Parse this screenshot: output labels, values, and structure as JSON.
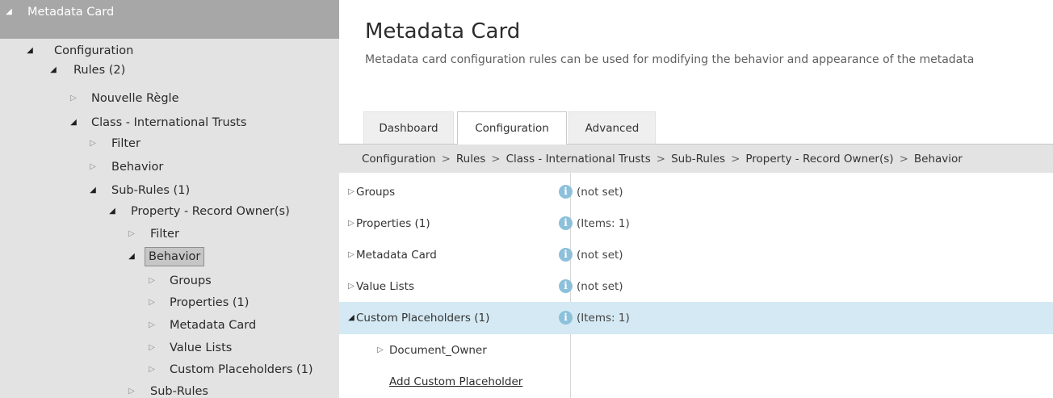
{
  "tree": {
    "nodes": [
      {
        "label": "Metadata Card",
        "expanded": true
      },
      {
        "label": "Configuration",
        "expanded": true
      },
      {
        "label": "Rules (2)",
        "expanded": true
      },
      {
        "label": "Nouvelle Règle",
        "expanded": false
      },
      {
        "label": "Class - International Trusts",
        "expanded": true
      },
      {
        "label": "Filter",
        "expanded": false
      },
      {
        "label": "Behavior",
        "expanded": false
      },
      {
        "label": "Sub-Rules (1)",
        "expanded": true
      },
      {
        "label": "Property - Record Owner(s)",
        "expanded": true
      },
      {
        "label": "Filter",
        "expanded": false
      },
      {
        "label": "Behavior",
        "expanded": true,
        "selected": true
      },
      {
        "label": "Groups",
        "expanded": false
      },
      {
        "label": "Properties (1)",
        "expanded": false
      },
      {
        "label": "Metadata Card",
        "expanded": false
      },
      {
        "label": "Value Lists",
        "expanded": false
      },
      {
        "label": "Custom Placeholders (1)",
        "expanded": false
      },
      {
        "label": "Sub-Rules",
        "expanded": false
      }
    ]
  },
  "header": {
    "title": "Metadata Card",
    "description": "Metadata card configuration rules can be used for modifying the behavior and appearance of the metadata"
  },
  "tabs": [
    {
      "label": "Dashboard",
      "active": false
    },
    {
      "label": "Configuration",
      "active": true
    },
    {
      "label": "Advanced",
      "active": false
    }
  ],
  "breadcrumb": [
    "Configuration",
    "Rules",
    "Class - International Trusts",
    "Sub-Rules",
    "Property - Record Owner(s)",
    "Behavior"
  ],
  "breadcrumb_separator": ">",
  "grid": {
    "rows": [
      {
        "name": "Groups",
        "value": "(not set)",
        "expanded": false
      },
      {
        "name": "Properties (1)",
        "value": "(Items: 1)",
        "expanded": false
      },
      {
        "name": "Metadata Card",
        "value": "(not set)",
        "expanded": false
      },
      {
        "name": "Value Lists",
        "value": "(not set)",
        "expanded": false
      },
      {
        "name": "Custom Placeholders (1)",
        "value": "(Items: 1)",
        "expanded": true,
        "selected": true
      }
    ],
    "child_row": {
      "name": "Document_Owner"
    },
    "add_link": "Add Custom Placeholder"
  },
  "glyphs": {
    "expanded": "◢",
    "collapsed": "▷",
    "info": "i"
  },
  "colors": {
    "tree_bg": "#e3e3e3",
    "tree_root_bg": "#a7a7a7",
    "selected_row_bg": "#d4e9f3",
    "info_icon": "#8cc0db",
    "breadcrumb_bg": "#e3e3e3"
  }
}
